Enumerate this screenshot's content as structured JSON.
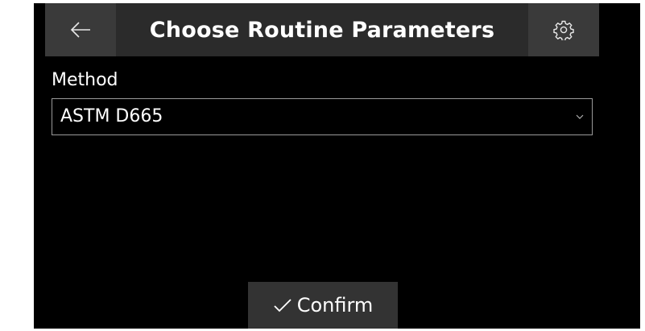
{
  "header": {
    "title": "Choose Routine Parameters",
    "back_icon": "arrow-left-icon",
    "settings_icon": "gear-icon"
  },
  "method": {
    "label": "Method",
    "selected_value": "ASTM D665",
    "dropdown_icon": "chevron-down-icon"
  },
  "footer": {
    "confirm_label": "Confirm",
    "confirm_icon": "checkmark-icon"
  },
  "colors": {
    "background": "#000000",
    "header_background": "#2b2b2b",
    "header_button_background": "#3a3a3a",
    "select_border": "#9a9a9a",
    "confirm_background": "#333333",
    "text": "#ffffff"
  }
}
